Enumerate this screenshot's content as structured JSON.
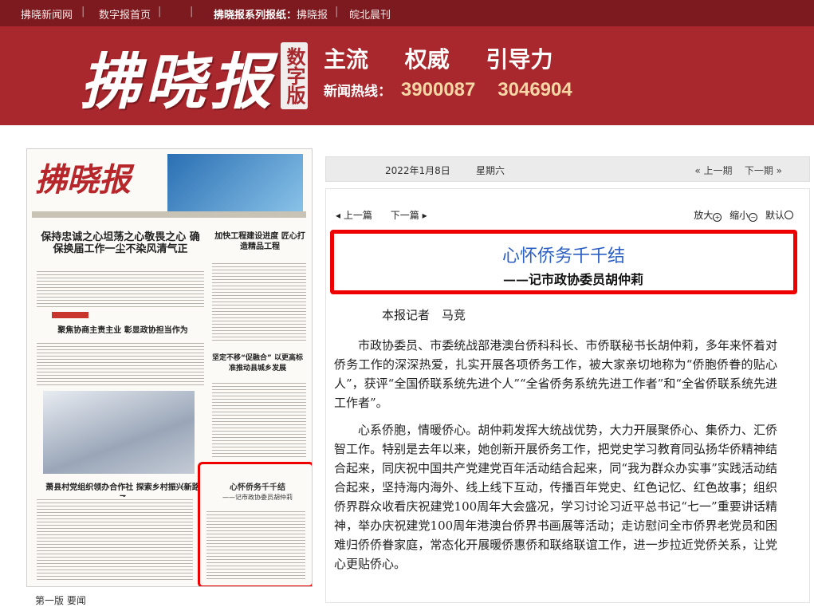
{
  "topnav": {
    "links": [
      "拂晓新闻网",
      "数字报首页"
    ],
    "series_label": "拂晓报系列报纸：",
    "papers": [
      "拂晓报",
      "皖北晨刊"
    ]
  },
  "header": {
    "logo_text": "拂晓报",
    "badge": "数字版",
    "slogans": [
      "主流",
      "权威",
      "引导力"
    ],
    "hotline_label": "新闻热线：",
    "hotline_numbers": [
      "3900087",
      "3046904"
    ]
  },
  "thumbnail": {
    "masthead": "拂晓报",
    "headline_main": "保持忠诚之心坦荡之心敬畏之心 确保换届工作一尘不染风清气正",
    "headline_right": "加快工程建设进度 匠心打造精品工程",
    "headline_left2": "聚焦协商主责主业 彰显政协担当作为",
    "headline_mid": "坚定不移“促融合” 以更高标准推动县城乡发展",
    "headline_bottom": "萧县村党组织领办合作社 探索乡村振兴新路子",
    "highlight_title": "心怀侨务千千结",
    "highlight_sub": "——记市政协委员胡仲莉"
  },
  "below_text": "第一版 要闻",
  "datebar": {
    "date": "2022年1月8日",
    "weekday": "星期六",
    "prev": "上一期",
    "next": "下一期"
  },
  "article_tools": {
    "prev": "上一篇",
    "next": "下一篇",
    "zoom_in": "放大",
    "zoom_out": "缩小",
    "default": "默认"
  },
  "article": {
    "title": "心怀侨务千千结",
    "subtitle": "——记市政协委员胡仲莉",
    "author": "本报记者　马竞",
    "paragraphs": [
      "市政协委员、市委统战部港澳台侨科科长、市侨联秘书长胡仲莉，多年来怀着对侨务工作的深深热爱，扎实开展各项侨务工作，被大家亲切地称为“侨胞侨眷的贴心人”，获评“全国侨联系统先进个人”“全省侨务系统先进工作者”和“全省侨联系统先进工作者”。",
      "心系侨胞，情暖侨心。胡仲莉发挥大统战优势，大力开展聚侨心、集侨力、汇侨智工作。特别是去年以来，她创新开展侨务工作，把党史学习教育同弘扬华侨精神结合起来，同庆祝中国共产党建党百年活动结合起来，同“我为群众办实事”实践活动结合起来，坚持海内海外、线上线下互动，传播百年党史、红色记忆、红色故事；组织侨界群众收看庆祝建党100周年大会盛况，学习讨论习近平总书记“七一”重要讲话精神，举办庆祝建党100周年港澳台侨界书画展等活动；走访慰问全市侨界老党员和困难归侨侨眷家庭，常态化开展暖侨惠侨和联络联谊工作，进一步拉近党侨关系，让党心更贴侨心。"
    ]
  }
}
